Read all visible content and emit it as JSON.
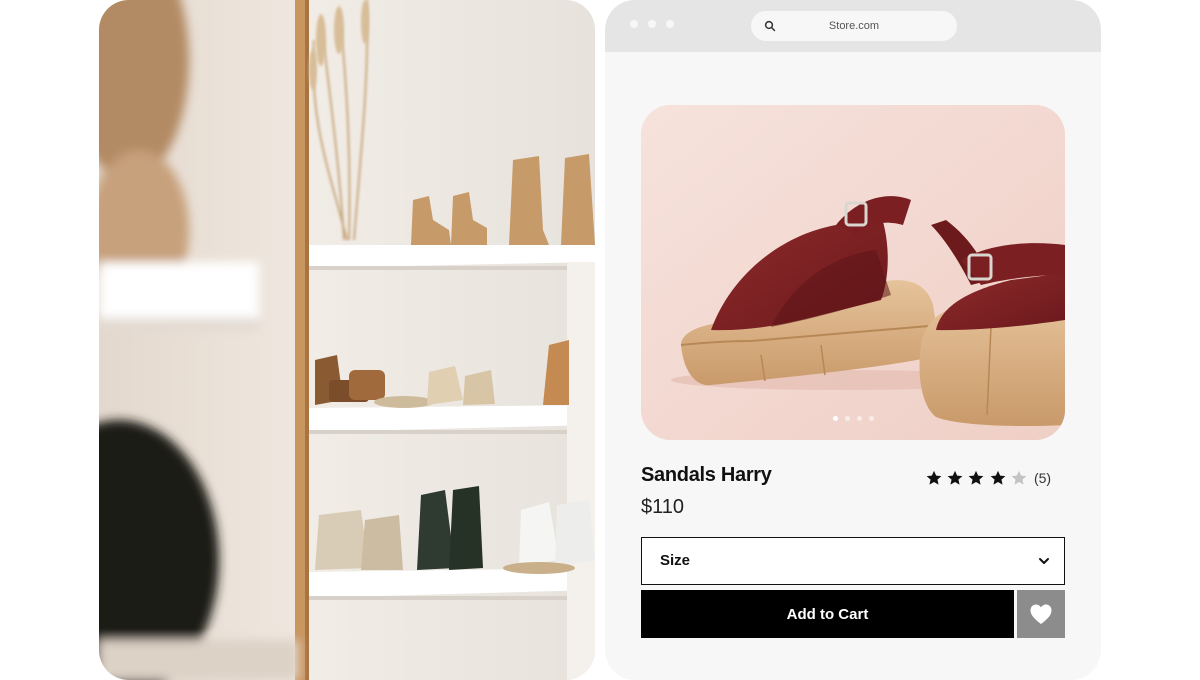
{
  "browser": {
    "address_url": "Store.com",
    "window_controls": [
      "dot",
      "dot",
      "dot"
    ]
  },
  "product": {
    "name": "Sandals Harry",
    "price": "$110",
    "rating_value": 4,
    "rating_max": 5,
    "review_count": "(5)",
    "image_count": 4,
    "active_image_index": 0
  },
  "size_select": {
    "label": "Size"
  },
  "actions": {
    "add_to_cart_label": "Add to Cart",
    "wishlist_icon": "heart-icon"
  },
  "icons": {
    "search": "search-icon",
    "dropdown": "chevron-down-icon",
    "star": "star-icon"
  },
  "colors": {
    "button_primary": "#000000",
    "wishlist_button": "#8c8c8c",
    "sandal_strap": "#7b1f22",
    "sandal_sole": "#d9b48c",
    "product_background": "#f2d8d1",
    "browser_bar": "#e5e5e5",
    "panel_background": "#f7f7f7"
  }
}
